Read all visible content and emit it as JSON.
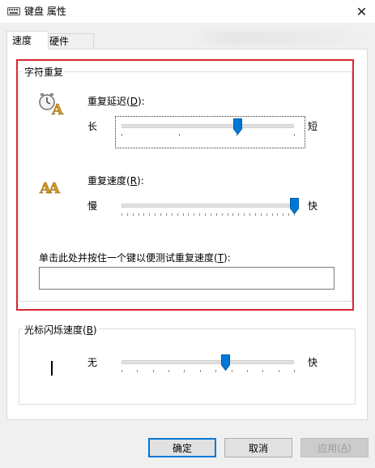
{
  "window": {
    "title": "键盘 属性",
    "close_glyph": "✕"
  },
  "tabs": [
    {
      "label": "速度",
      "selected": true
    },
    {
      "label": "硬件",
      "selected": false
    }
  ],
  "char_repeat": {
    "legend": "字符重复",
    "delay": {
      "label_prefix": "重复延迟(",
      "label_key": "D",
      "label_suffix": "):",
      "left_label": "长",
      "right_label": "短",
      "tick_count": 4,
      "value_fraction": 0.67
    },
    "rate": {
      "label_prefix": "重复速度(",
      "label_key": "R",
      "label_suffix": "):",
      "left_label": "慢",
      "right_label": "快",
      "tick_count": 32,
      "value_fraction": 1.0
    },
    "test": {
      "label_prefix": "单击此处并按住一个键以便测试重复速度(",
      "label_key": "T",
      "label_suffix": "):",
      "value": ""
    }
  },
  "cursor_blink": {
    "legend_prefix": "光标闪烁速度(",
    "legend_key": "B",
    "legend_suffix": ")",
    "left_label": "无",
    "right_label": "快",
    "tick_count": 12,
    "value_fraction": 0.6
  },
  "buttons": {
    "ok": "确定",
    "cancel": "取消",
    "apply_prefix": "应用(",
    "apply_key": "A",
    "apply_suffix": ")"
  },
  "colors": {
    "highlight_red": "#d7282f",
    "accent_blue": "#0078d7"
  }
}
